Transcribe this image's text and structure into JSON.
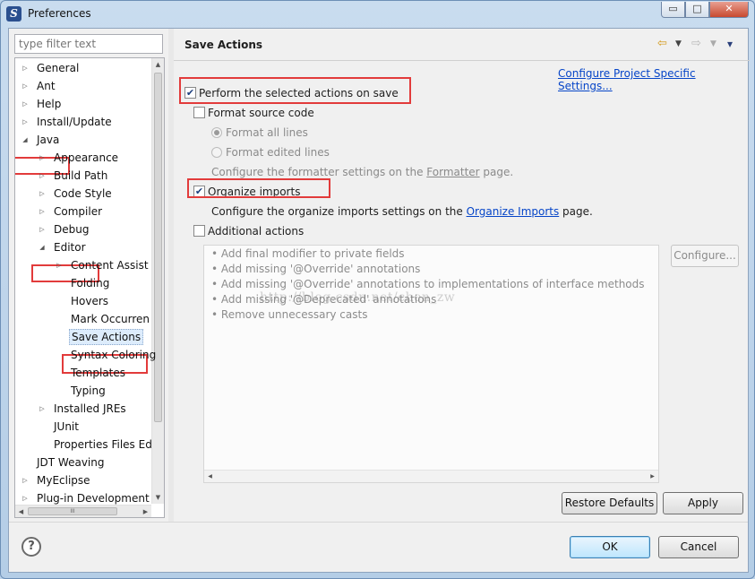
{
  "window": {
    "title": "Preferences",
    "minimize": "▭",
    "maximize": "□",
    "close": "✕",
    "app_icon": "S"
  },
  "filter": {
    "placeholder": "type filter text"
  },
  "tree": {
    "items": [
      {
        "label": "General",
        "expanded": false
      },
      {
        "label": "Ant",
        "expanded": false
      },
      {
        "label": "Help",
        "expanded": false
      },
      {
        "label": "Install/Update",
        "expanded": false
      },
      {
        "label": "Java",
        "expanded": true
      },
      {
        "label": "Appearance",
        "expanded": false
      },
      {
        "label": "Build Path",
        "expanded": false
      },
      {
        "label": "Code Style",
        "expanded": false
      },
      {
        "label": "Compiler",
        "expanded": false
      },
      {
        "label": "Debug",
        "expanded": false
      },
      {
        "label": "Editor",
        "expanded": true
      },
      {
        "label": "Content Assist",
        "expanded": false
      },
      {
        "label": "Folding"
      },
      {
        "label": "Hovers"
      },
      {
        "label": "Mark Occurren"
      },
      {
        "label": "Save Actions",
        "selected": true
      },
      {
        "label": "Syntax Coloring"
      },
      {
        "label": "Templates"
      },
      {
        "label": "Typing"
      },
      {
        "label": "Installed JREs",
        "expanded": false
      },
      {
        "label": "JUnit"
      },
      {
        "label": "Properties Files Ed"
      },
      {
        "label": "JDT Weaving"
      },
      {
        "label": "MyEclipse",
        "expanded": false
      },
      {
        "label": "Plug-in Development",
        "expanded": false
      }
    ],
    "hscroll_grip": "III"
  },
  "page": {
    "title": "Save Actions",
    "nav_back": "⇦",
    "nav_forward": "⇨",
    "nav_menu": "▾",
    "configure_link": "Configure Project Specific Settings...",
    "perform_label": "Perform the selected actions on save",
    "perform_checked": true,
    "format_label": "Format source code",
    "format_checked": false,
    "format_all": "Format all lines",
    "format_edited": "Format edited lines",
    "formatter_prefix": "Configure the formatter settings on the ",
    "formatter_link": "Formatter",
    "formatter_suffix": " page.",
    "organize_label": "Organize imports",
    "organize_checked": true,
    "organize_prefix": "Configure the organize imports settings on the ",
    "organize_link": "Organize Imports",
    "organize_suffix": " page.",
    "additional_label": "Additional actions",
    "additional_checked": false,
    "actions": [
      "Add final modifier to private fields",
      "Add missing '@Override' annotations",
      "Add missing '@Override' annotations to implementations of interface methods",
      "Add missing '@Deprecated' annotations",
      "Remove unnecessary casts"
    ],
    "configure_button": "Configure...",
    "restore_button": "Restore Defaults",
    "apply_button": "Apply"
  },
  "footer": {
    "help": "?",
    "ok": "OK",
    "cancel": "Cancel"
  },
  "watermark": "http://blog.csdn.net/chen_zw"
}
